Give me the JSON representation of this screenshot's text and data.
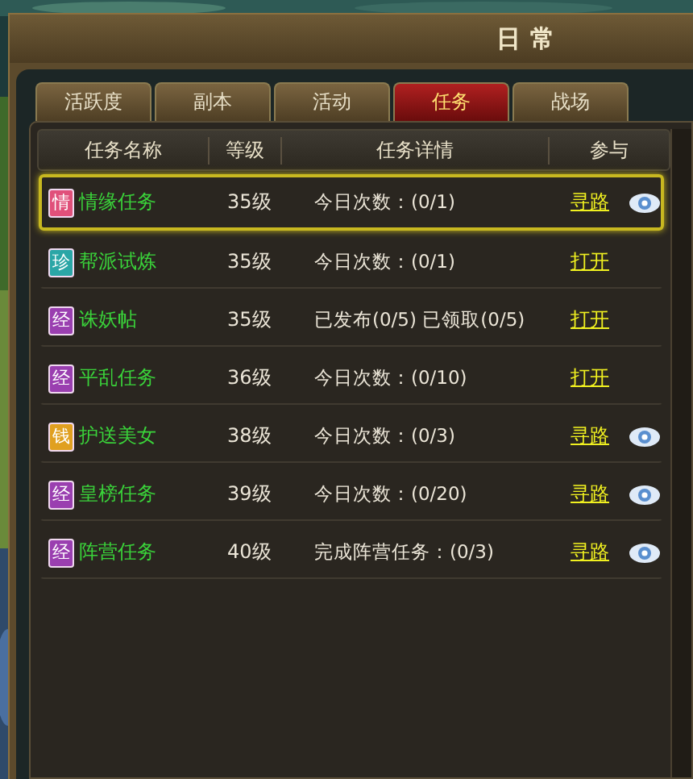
{
  "window": {
    "title": "日常"
  },
  "tabs": [
    {
      "label": "活跃度",
      "selected": false
    },
    {
      "label": "副本",
      "selected": false
    },
    {
      "label": "活动",
      "selected": false
    },
    {
      "label": "任务",
      "selected": true
    },
    {
      "label": "战场",
      "selected": false
    }
  ],
  "table": {
    "columns": [
      "任务名称",
      "等级",
      "任务详情",
      "参与"
    ],
    "rows": [
      {
        "badge": "情",
        "color": "#e0507a",
        "name": "情缘任务",
        "level": "35级",
        "detail": "今日次数：(0/1)",
        "action": "寻路",
        "track": true,
        "selected": true
      },
      {
        "badge": "珍",
        "color": "#2aa6a6",
        "name": "帮派试炼",
        "level": "35级",
        "detail": "今日次数：(0/1)",
        "action": "打开",
        "track": false,
        "selected": false
      },
      {
        "badge": "经",
        "color": "#9a3fb0",
        "name": "诛妖帖",
        "level": "35级",
        "detail": "已发布(0/5)  已领取(0/5)",
        "action": "打开",
        "track": false,
        "selected": false
      },
      {
        "badge": "经",
        "color": "#9a3fb0",
        "name": "平乱任务",
        "level": "36级",
        "detail": "今日次数：(0/10)",
        "action": "打开",
        "track": false,
        "selected": false
      },
      {
        "badge": "钱",
        "color": "#e0a020",
        "name": "护送美女",
        "level": "38级",
        "detail": "今日次数：(0/3)",
        "action": "寻路",
        "track": true,
        "selected": false
      },
      {
        "badge": "经",
        "color": "#9a3fb0",
        "name": "皇榜任务",
        "level": "39级",
        "detail": "今日次数：(0/20)",
        "action": "寻路",
        "track": true,
        "selected": false
      },
      {
        "badge": "经",
        "color": "#9a3fb0",
        "name": "阵营任务",
        "level": "40级",
        "detail": "完成阵营任务：(0/3)",
        "action": "寻路",
        "track": true,
        "selected": false
      }
    ]
  }
}
